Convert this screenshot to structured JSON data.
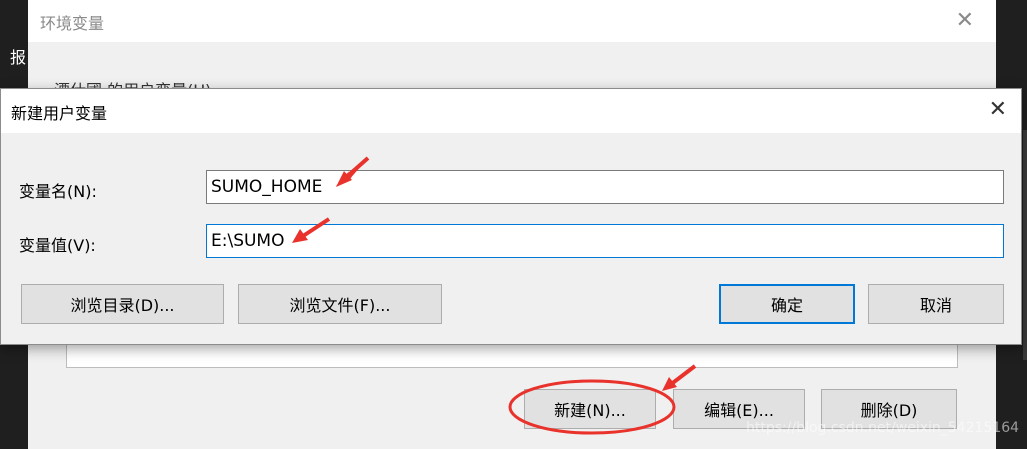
{
  "background": {
    "edge_char": "报"
  },
  "env_window": {
    "title": "环境变量",
    "close_glyph": "✕",
    "section_label": "漂仕國 的用户变量(U)",
    "buttons": {
      "new": "新建(N)...",
      "edit": "编辑(E)...",
      "delete": "删除(D)"
    }
  },
  "dialog": {
    "title": "新建用户变量",
    "close_glyph": "✕",
    "name_label": "变量名(N):",
    "name_value": "SUMO_HOME",
    "value_label": "变量值(V):",
    "value_value": "E:\\SUMO",
    "buttons": {
      "browse_dir": "浏览目录(D)...",
      "browse_file": "浏览文件(F)...",
      "ok": "确定",
      "cancel": "取消"
    }
  },
  "annotations": {
    "arrow_color": "#e8322b",
    "ellipse_color": "#e8322b"
  },
  "watermark": "https://blog.csdn.net/weixin_54215164"
}
